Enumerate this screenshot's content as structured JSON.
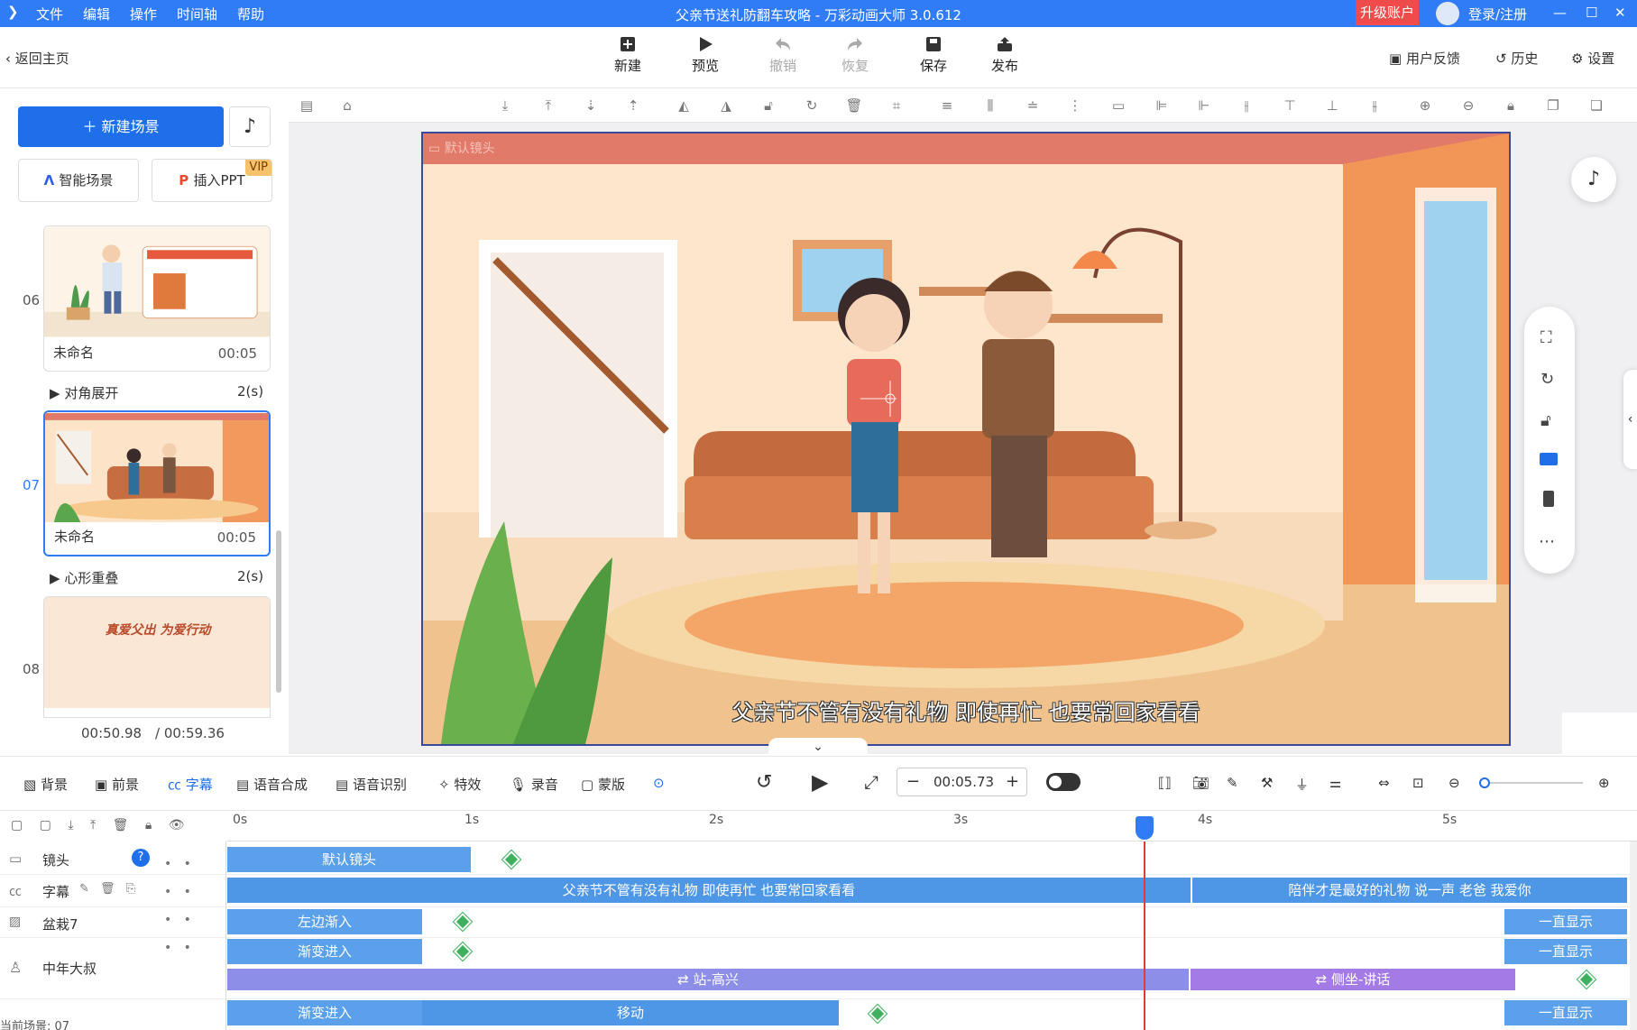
{
  "menu": [
    "文件",
    "编辑",
    "操作",
    "时间轴",
    "帮助"
  ],
  "window_title": "父亲节送礼防翻车攻略 - 万彩动画大师 3.0.612",
  "upgrade_label": "升级账户",
  "login_label": "登录/注册",
  "back_label": "返回主页",
  "toolbar": {
    "new": "新建",
    "preview": "预览",
    "undo": "撤销",
    "redo": "恢复",
    "save": "保存",
    "publish": "发布"
  },
  "top_right": {
    "feedback": "用户反馈",
    "history": "历史",
    "settings": "设置"
  },
  "left": {
    "new_scene": "新建场景",
    "smart_scene": "智能场景",
    "insert_ppt": "插入PPT",
    "vip": "VIP",
    "scenes": [
      {
        "num": "06",
        "name": "未命名",
        "time": "00:05",
        "transition": "对角展开",
        "trans_dur": "2(s)"
      },
      {
        "num": "07",
        "name": "未命名",
        "time": "00:05",
        "transition": "心形重叠",
        "trans_dur": "2(s)"
      },
      {
        "num": "08",
        "name": "",
        "time": "",
        "thumb_text": "真爱父出  为爱行动"
      }
    ],
    "current_time": "00:50.98",
    "total_time": "/ 00:59.36"
  },
  "stage": {
    "camera_label": "默认镜头",
    "subtitle": "父亲节不管有没有礼物 即使再忙 也要常回家看看"
  },
  "bottom_tools": [
    "背景",
    "前景",
    "字幕",
    "语音合成",
    "语音识别",
    "特效",
    "录音",
    "蒙版"
  ],
  "timecode": "00:05.73",
  "timeline": {
    "ticks": [
      "0s",
      "1s",
      "2s",
      "3s",
      "4s",
      "5s"
    ],
    "tracks": {
      "camera": "镜头",
      "subtitle": "字幕",
      "plant": "盆栽7",
      "man": "中年大叔"
    },
    "clips": {
      "camera": "默认镜头",
      "sub1": "父亲节不管有没有礼物 即使再忙 也要常回家看看",
      "sub2": "陪伴才是最好的礼物 说一声 老爸 我爱你",
      "left_in": "左边渐入",
      "fade_in": "渐变进入",
      "always": "一直显示",
      "stand": "站-高兴",
      "talk": "侧坐-讲话",
      "move": "移动"
    },
    "current_scene": "当前场景: 07"
  },
  "colors": {
    "accent": "#2f7cf6",
    "clip_blue": "#5aa0ea",
    "clip_purple": "#8c8ee8",
    "playhead": "#e53935"
  }
}
